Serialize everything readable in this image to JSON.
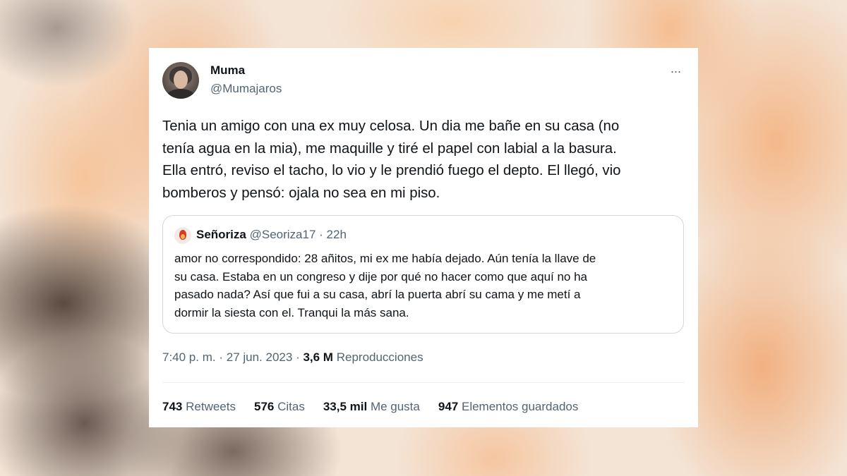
{
  "tweet": {
    "author_name": "Muma",
    "author_handle": "@Mumajaros",
    "more_icon": "···",
    "text": "Tenia un amigo con una ex muy celosa. Un dia me bañe en su casa (no\ntenía agua en la mia), me maquille y tiré el papel con labial a la basura.\nElla entró, reviso el tacho, lo vio y le prendió fuego el depto.  El llegó, vio\nbomberos y pensó: ojala no sea en mi piso.",
    "quoted": {
      "author_name": "Señoriza",
      "author_handle": "@Seoriza17",
      "time_ago": "22h",
      "text": "amor no correspondido: 28 añitos, mi ex me había dejado. Aún tenía la llave de\nsu casa. Estaba en un congreso y dije por qué no hacer como que aquí no ha\npasado nada? Así que fui a su casa, abrí la puerta abrí su cama y me metí a\ndormir la siesta con el. Tranqui la más sana."
    },
    "time": "7:40 p. m.",
    "date": "27 jun. 2023",
    "views_count": "3,6 M",
    "views_label": "Reproducciones",
    "stats": [
      {
        "count": "743",
        "label": "Retweets"
      },
      {
        "count": "576",
        "label": "Citas"
      },
      {
        "count": "33,5 mil",
        "label": "Me gusta"
      },
      {
        "count": "947",
        "label": "Elementos guardados"
      }
    ]
  },
  "colors": {
    "text_primary": "#0f1419",
    "text_secondary": "#536471",
    "border": "#cfd9de"
  }
}
